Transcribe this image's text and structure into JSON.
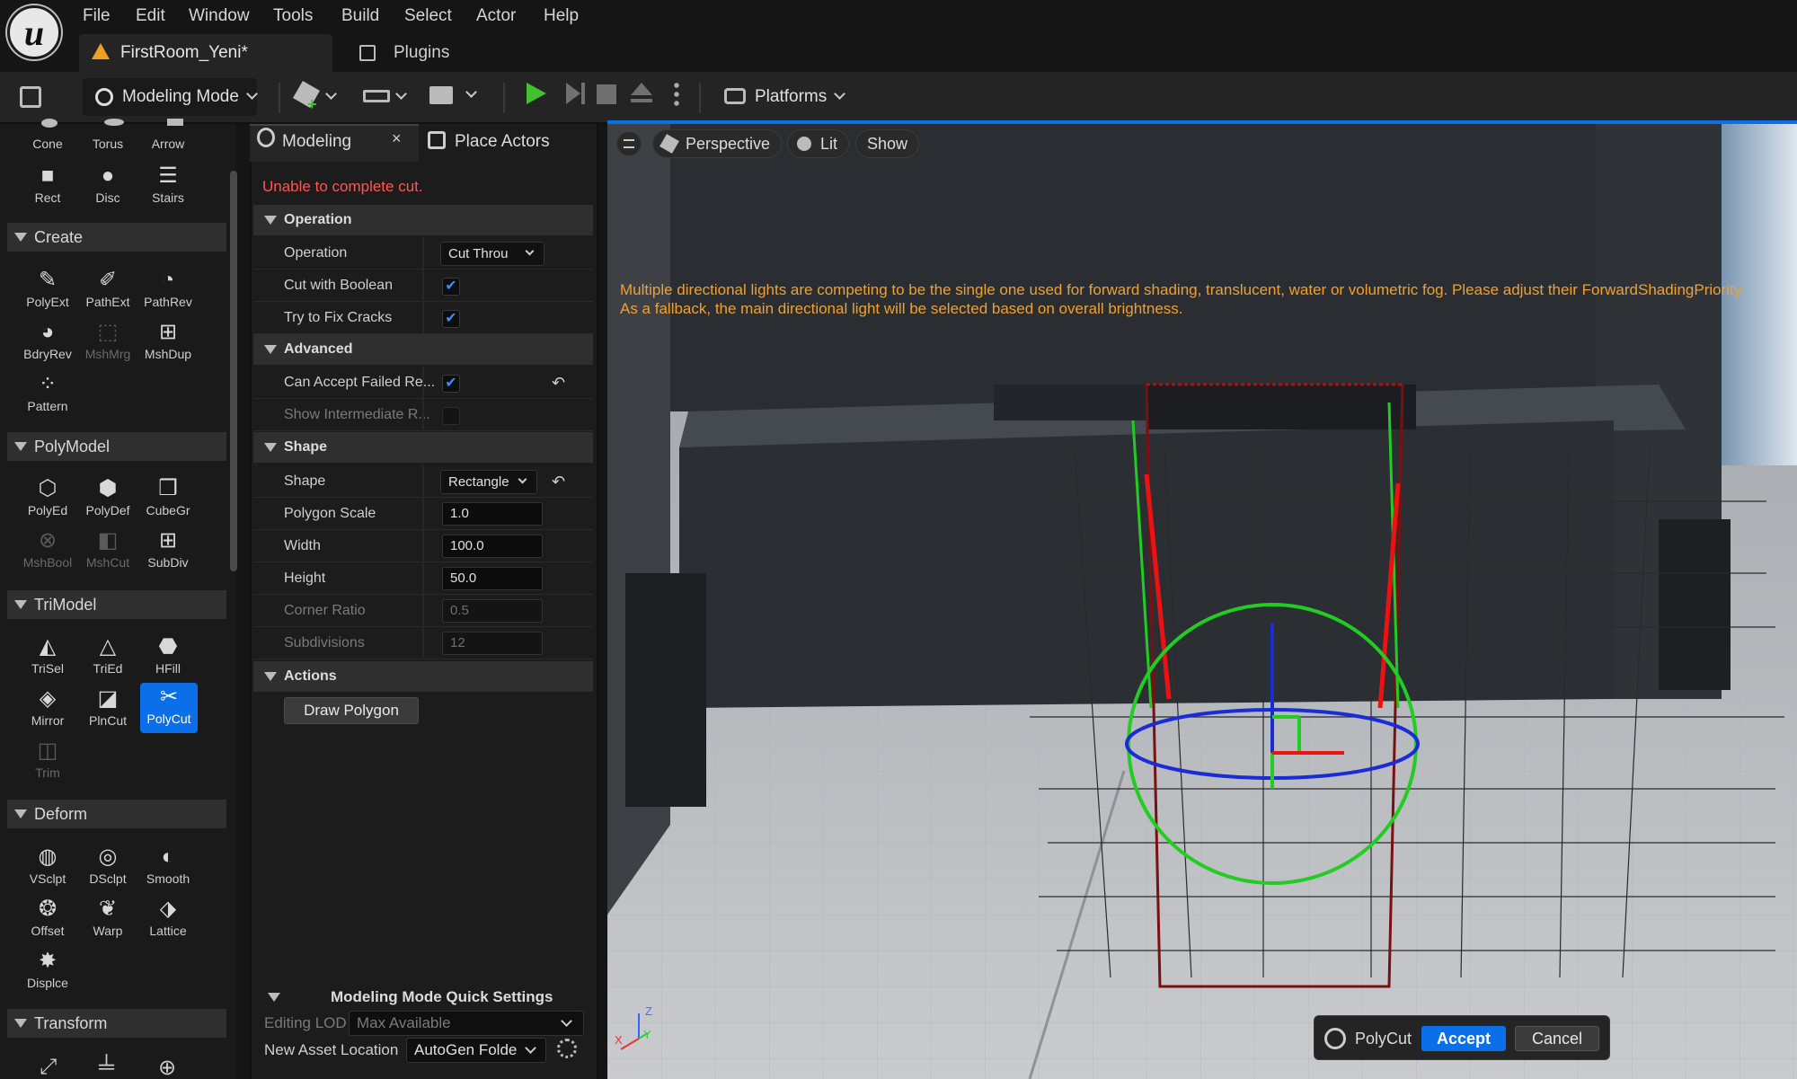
{
  "app": {
    "menu": [
      "File",
      "Edit",
      "Window",
      "Tools",
      "Build",
      "Select",
      "Actor",
      "Help"
    ],
    "document_tab": "FirstRoom_Yeni*",
    "plugins_tab": "Plugins"
  },
  "toolbar": {
    "mode_label": "Modeling Mode",
    "platforms_label": "Platforms",
    "play_color": "#43c030"
  },
  "palette": {
    "shapes_row1": [
      "Cone",
      "Torus",
      "Arrow"
    ],
    "shapes_row2": [
      "Rect",
      "Disc",
      "Stairs"
    ],
    "create": {
      "title": "Create",
      "tools": [
        "PolyExt",
        "PathExt",
        "PathRev",
        "BdryRev",
        "MshMrg",
        "MshDup",
        "Pattern"
      ]
    },
    "polymodel": {
      "title": "PolyModel",
      "tools": [
        "PolyEd",
        "PolyDef",
        "CubeGr",
        "MshBool",
        "MshCut",
        "SubDiv"
      ]
    },
    "trimodel": {
      "title": "TriModel",
      "tools": [
        "TriSel",
        "TriEd",
        "HFill",
        "Mirror",
        "PlnCut",
        "PolyCut",
        "Trim"
      ]
    },
    "deform": {
      "title": "Deform",
      "tools": [
        "VSclpt",
        "DSclpt",
        "Smooth",
        "Offset",
        "Warp",
        "Lattice",
        "Displce"
      ]
    },
    "transform": {
      "title": "Transform"
    }
  },
  "details": {
    "tab_modeling": "Modeling",
    "tab_place": "Place Actors",
    "error": "Unable to complete cut.",
    "operation_cat": "Operation",
    "operation_label": "Operation",
    "operation_value": "Cut Throu",
    "cut_boolean": "Cut with Boolean",
    "fix_cracks": "Try to Fix Cracks",
    "advanced_cat": "Advanced",
    "accept_failed": "Can Accept Failed Re...",
    "show_intermediate": "Show Intermediate R...",
    "shape_cat": "Shape",
    "shape_label": "Shape",
    "shape_value": "Rectangle",
    "polygon_scale": "Polygon Scale",
    "polygon_scale_value": "1.0",
    "width": "Width",
    "width_value": "100.0",
    "height": "Height",
    "height_value": "50.0",
    "corner_ratio": "Corner Ratio",
    "corner_ratio_value": "0.5",
    "subdivisions": "Subdivisions",
    "subdivisions_value": "12",
    "actions_cat": "Actions",
    "draw_polygon": "Draw Polygon",
    "quick_settings": "Modeling Mode Quick Settings",
    "editing_lod": "Editing LOD",
    "editing_lod_value": "Max Available",
    "new_asset_location": "New Asset Location",
    "new_asset_location_value": "AutoGen Folde"
  },
  "viewport": {
    "perspective": "Perspective",
    "lit": "Lit",
    "show": "Show",
    "warning_line1": "Multiple directional lights are competing to be the single one used for forward shading, translucent, water or volumetric fog. Please adjust their ForwardShadingPriority.",
    "warning_line2": "As a fallback, the main directional light will be selected based on overall brightness.",
    "axis_z": "Z",
    "axis_y": "Y",
    "axis_x": "X"
  },
  "polycut": {
    "label": "PolyCut",
    "accept": "Accept",
    "cancel": "Cancel"
  }
}
